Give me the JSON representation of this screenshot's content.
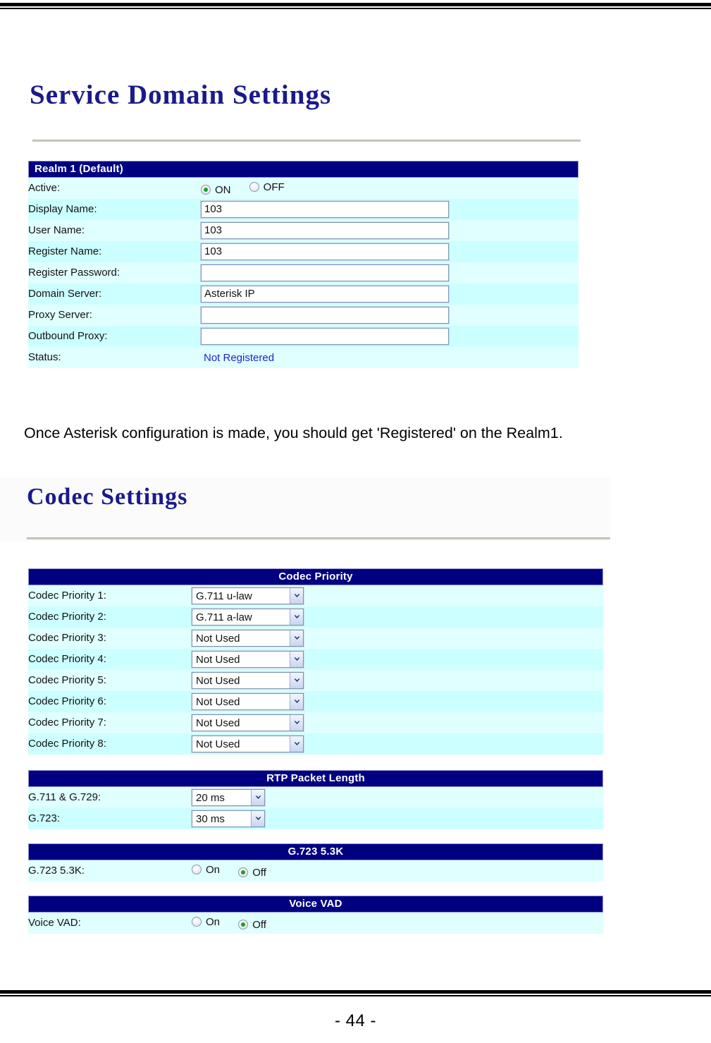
{
  "page": {
    "number": "- 44 -"
  },
  "service_domain": {
    "title": "Service Domain Settings",
    "realm_header": "Realm 1 (Default)",
    "rows": [
      {
        "label": "Active:",
        "type": "radio",
        "options": [
          "ON",
          "OFF"
        ],
        "selected": "ON"
      },
      {
        "label": "Display Name:",
        "type": "text",
        "value": "103",
        "placeholder": ""
      },
      {
        "label": "User Name:",
        "type": "text",
        "value": "103",
        "placeholder": ""
      },
      {
        "label": "Register Name:",
        "type": "text",
        "value": "103",
        "placeholder": ""
      },
      {
        "label": "Register Password:",
        "type": "text",
        "value": "",
        "placeholder": ""
      },
      {
        "label": "Domain Server:",
        "type": "text",
        "value": "Asterisk IP",
        "placeholder": ""
      },
      {
        "label": "Proxy Server:",
        "type": "text",
        "value": "",
        "placeholder": ""
      },
      {
        "label": "Outbound Proxy:",
        "type": "text",
        "value": "",
        "placeholder": ""
      },
      {
        "label": "Status:",
        "type": "status",
        "value": "Not Registered"
      }
    ]
  },
  "note": "Once Asterisk configuration is made, you should get 'Registered' on the Realm1.",
  "codec": {
    "title": "Codec Settings",
    "priority": {
      "header": "Codec Priority",
      "rows": [
        {
          "label": "Codec Priority 1:",
          "value": "G.711 u-law"
        },
        {
          "label": "Codec Priority 2:",
          "value": "G.711 a-law"
        },
        {
          "label": "Codec Priority 3:",
          "value": "Not Used"
        },
        {
          "label": "Codec Priority 4:",
          "value": "Not Used"
        },
        {
          "label": "Codec Priority 5:",
          "value": "Not Used"
        },
        {
          "label": "Codec Priority 6:",
          "value": "Not Used"
        },
        {
          "label": "Codec Priority 7:",
          "value": "Not Used"
        },
        {
          "label": "Codec Priority 8:",
          "value": "Not Used"
        }
      ]
    },
    "rtp_packet_length": {
      "header": "RTP Packet Length",
      "rows": [
        {
          "label": "G.711 & G.729:",
          "value": "20 ms"
        },
        {
          "label": "G.723:",
          "value": "30 ms"
        }
      ]
    },
    "g723_53k": {
      "header": "G.723 5.3K",
      "row": {
        "label": "G.723 5.3K:",
        "options": [
          "On",
          "Off"
        ],
        "selected": "Off"
      }
    },
    "voice_vad": {
      "header": "Voice VAD",
      "row": {
        "label": "Voice VAD:",
        "options": [
          "On",
          "Off"
        ],
        "selected": "Off"
      }
    }
  },
  "colors": {
    "header_blue": "#000080",
    "row_light": "#e0ffff",
    "row_dark": "#ccffff",
    "heading_navy": "#1a1a8c",
    "status_blue": "#2222cc",
    "radio_dot_green": "#1ea01e"
  }
}
